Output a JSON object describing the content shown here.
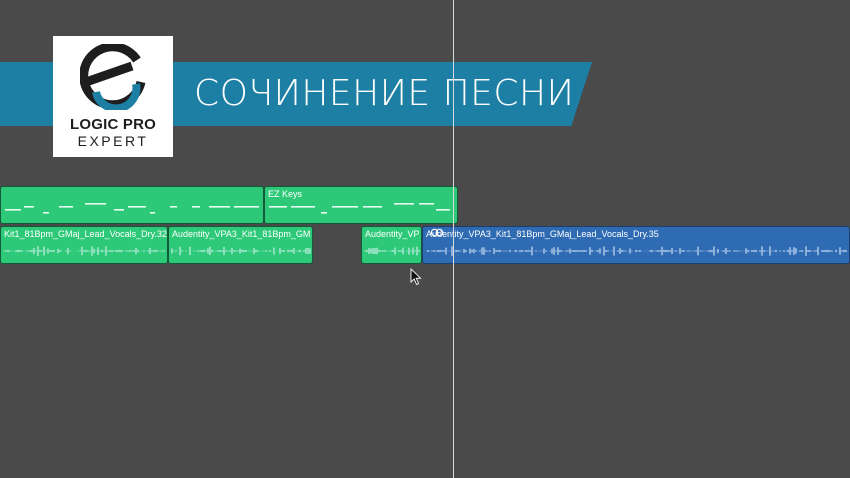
{
  "banner": {
    "title": "СОЧИНЕНИЕ ПЕСНИ",
    "logo_line1": "LOGIC PRO",
    "logo_line2": "EXPERT"
  },
  "colors": {
    "background": "#4a4a4a",
    "banner": "#1d7fa3",
    "region_green": "#2ec978",
    "region_blue": "#2f6bb3"
  },
  "tracks": {
    "midi": [
      {
        "name": ""
      },
      {
        "name": "EZ Keys"
      }
    ],
    "audio": [
      {
        "name": "Kit1_81Bpm_GMaj_Lead_Vocals_Dry.32"
      },
      {
        "name": "Audentity_VPA3_Kit1_81Bpm_GM"
      },
      {
        "name": "Audentity_VP"
      },
      {
        "name": "Audentity_VPA3_Kit1_81Bpm_GMaj_Lead_Vocals_Dry.35",
        "selected": true,
        "link_icon": "loop-link-icon"
      }
    ]
  }
}
